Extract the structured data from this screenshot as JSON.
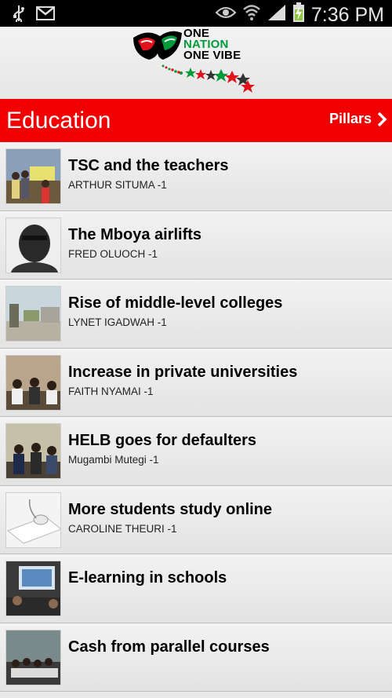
{
  "status_bar": {
    "time": "7:36 PM",
    "icons": [
      "usb-icon",
      "gmail-icon",
      "eye-icon",
      "wifi-icon",
      "signal-icon",
      "battery-charging-icon"
    ]
  },
  "logo": {
    "line1": "ONE",
    "line2": "NATION",
    "line3": "ONE VIBE",
    "colors": {
      "red": "#e1121b",
      "green": "#009a3a",
      "black": "#000000"
    }
  },
  "title_bar": {
    "title": "Education",
    "pillars_label": "Pillars",
    "background": "#f00000"
  },
  "articles": [
    {
      "title": "TSC and the teachers",
      "author": "ARTHUR SITUMA -1"
    },
    {
      "title": "The Mboya airlifts",
      "author": "FRED OLUOCH -1"
    },
    {
      "title": "Rise of middle-level colleges",
      "author": "LYNET IGADWAH -1"
    },
    {
      "title": "Increase in private universities",
      "author": "FAITH NYAMAI -1"
    },
    {
      "title": "HELB goes for defaulters",
      "author": "Mugambi Mutegi -1"
    },
    {
      "title": "More students study online",
      "author": "CAROLINE THEURI -1"
    },
    {
      "title": "E-learning in schools",
      "author": ""
    },
    {
      "title": "Cash from parallel courses",
      "author": ""
    }
  ]
}
